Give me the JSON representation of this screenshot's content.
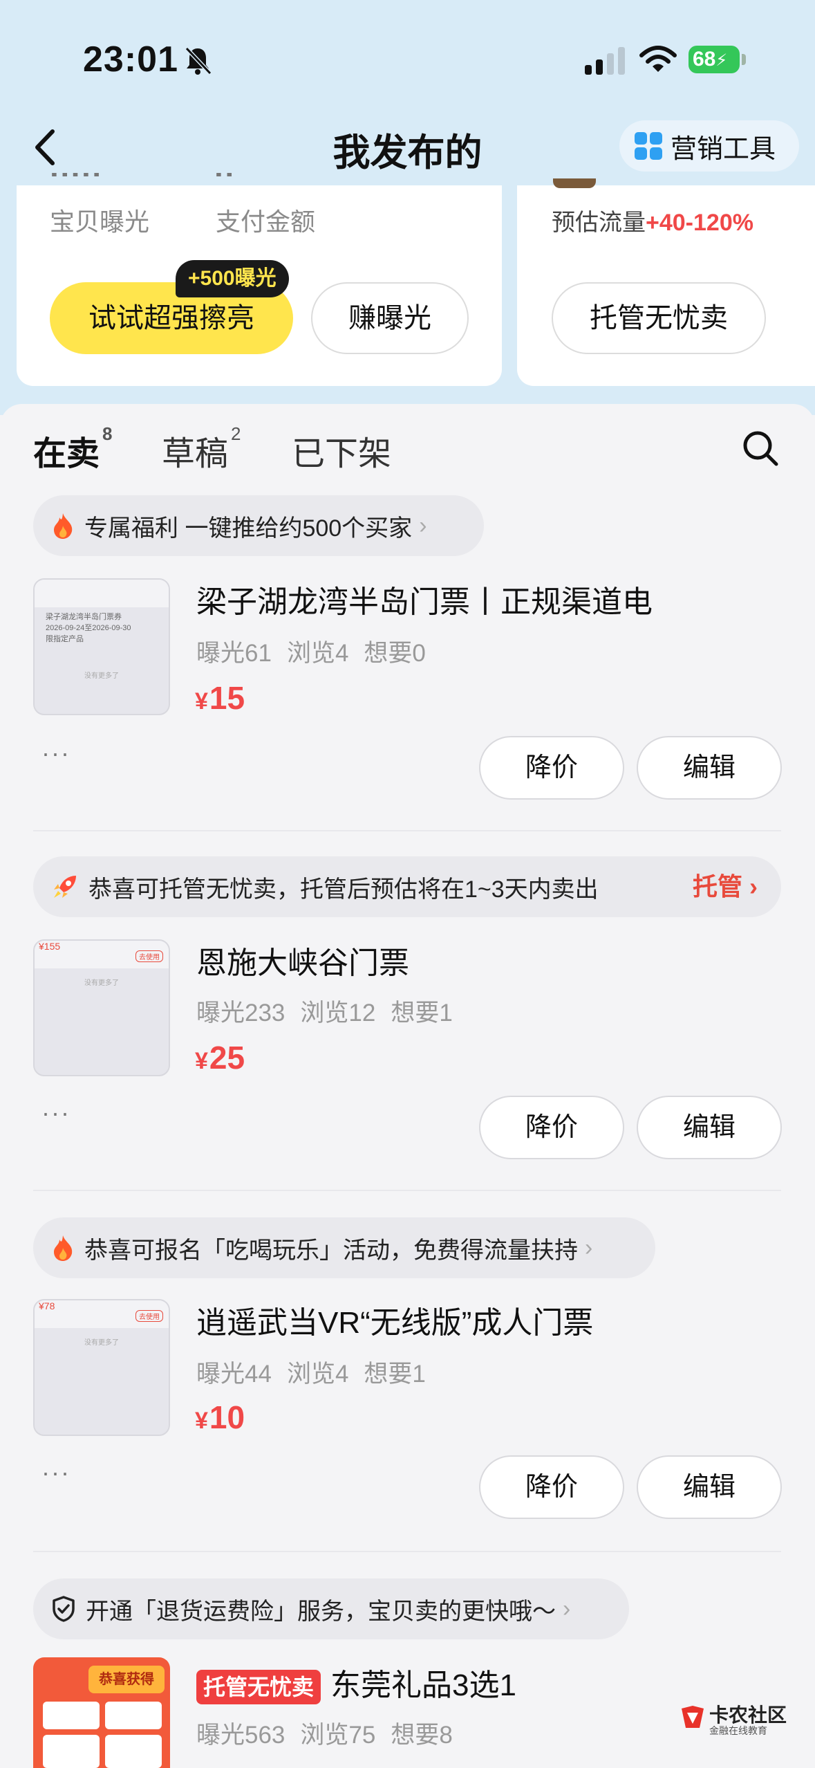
{
  "status_bar": {
    "time": "23:01",
    "battery": "68"
  },
  "nav": {
    "title": "我发布的",
    "tool_label": "营销工具"
  },
  "stats": {
    "exposure_label": "宝贝曝光",
    "payment_label": "支付金额",
    "boost_button": "试试超强擦亮",
    "boost_badge": "+500曝光",
    "earn_button": "赚曝光",
    "traffic_label": "预估流量",
    "traffic_value": "+40-120%",
    "managed_button": "托管无忧卖"
  },
  "tabs": [
    {
      "label": "在卖",
      "count": "8"
    },
    {
      "label": "草稿",
      "count": "2"
    },
    {
      "label": "已下架",
      "count": ""
    }
  ],
  "listings": [
    {
      "banner": "专属福利 一键推给约500个买家",
      "banner_link": "",
      "title": "梁子湖龙湾半岛门票丨正规渠道电",
      "exposure": "曝光61",
      "views": "浏览4",
      "wants": "想要0",
      "currency": "¥",
      "price": "15",
      "more": "···",
      "price_cut": "降价",
      "edit": "编辑"
    },
    {
      "banner": "恭喜可托管无忧卖，托管后预估将在1~3天内卖出",
      "banner_link": "托管",
      "title": "恩施大峡谷门票",
      "exposure": "曝光233",
      "views": "浏览12",
      "wants": "想要1",
      "currency": "¥",
      "price": "25",
      "more": "···",
      "price_cut": "降价",
      "edit": "编辑"
    },
    {
      "banner": "恭喜可报名「吃喝玩乐」活动，免费得流量扶持",
      "banner_link": "",
      "title": "逍遥武当VR“无线版”成人门票",
      "exposure": "曝光44",
      "views": "浏览4",
      "wants": "想要1",
      "currency": "¥",
      "price": "10",
      "more": "···",
      "price_cut": "降价",
      "edit": "编辑"
    },
    {
      "banner": "开通「退货运费险」服务，宝贝卖的更快哦～",
      "badge": "托管无忧卖",
      "title": "东莞礼品3选1",
      "exposure": "曝光563",
      "views": "浏览75",
      "wants": "想要8"
    }
  ],
  "thumb_text": {
    "t1_line1": "梁子湖龙湾半岛门票券",
    "t1_line2": "2026-09-24至2026-09-30",
    "t1_line3": "限指定产品",
    "t1_empty": "没有更多了",
    "t2_price": "¥155",
    "t3_price": "¥78",
    "tag": "去使用",
    "t4_title": "恭喜获得"
  },
  "watermark": {
    "name": "卡农社区",
    "sub": "金融在线教育"
  },
  "colors": {
    "accent_yellow": "#ffe54d",
    "price_red": "#f04848",
    "top_bg": "#d8ebf7"
  }
}
